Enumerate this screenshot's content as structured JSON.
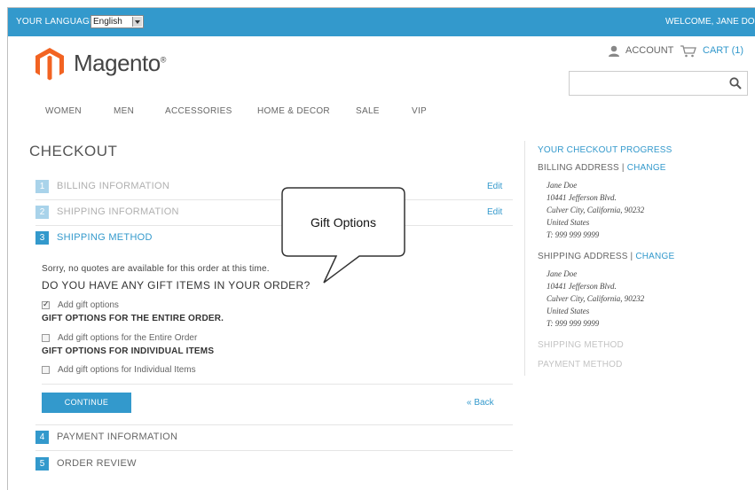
{
  "topbar": {
    "language_label": "YOUR LANGUAGE:",
    "language_value": "English",
    "welcome": "WELCOME, JANE DOE"
  },
  "header": {
    "logo_text": "Magento",
    "logo_mark": "®",
    "account": "ACCOUNT",
    "cart": "CART (1)",
    "search_placeholder": ""
  },
  "nav": [
    "WOMEN",
    "MEN",
    "ACCESSORIES",
    "HOME & DECOR",
    "SALE",
    "VIP"
  ],
  "page_title": "CHECKOUT",
  "steps": [
    {
      "num": "1",
      "label": "BILLING INFORMATION",
      "edit": "Edit"
    },
    {
      "num": "2",
      "label": "SHIPPING INFORMATION",
      "edit": "Edit"
    },
    {
      "num": "3",
      "label": "SHIPPING METHOD"
    },
    {
      "num": "4",
      "label": "PAYMENT INFORMATION"
    },
    {
      "num": "5",
      "label": "ORDER REVIEW"
    }
  ],
  "shipping_method": {
    "message": "Sorry, no quotes are available for this order at this time.",
    "question": "DO YOU HAVE ANY GIFT ITEMS IN YOUR ORDER?",
    "add_gift": {
      "label": "Add gift options",
      "checked": true
    },
    "entire_order_head": "GIFT OPTIONS FOR THE ENTIRE ORDER.",
    "entire_order": {
      "label": "Add gift options for the Entire Order",
      "checked": false
    },
    "individual_head": "GIFT OPTIONS FOR INDIVIDUAL ITEMS",
    "individual": {
      "label": "Add gift options for Individual Items",
      "checked": false
    },
    "continue": "CONTINUE",
    "back": "« Back"
  },
  "callout": "Gift Options",
  "progress": {
    "title": "YOUR CHECKOUT PROGRESS",
    "billing_label": "BILLING ADDRESS",
    "separator": " | ",
    "change": "CHANGE",
    "billing_address": [
      "Jane Doe",
      "10441 Jefferson Blvd.",
      "Culver City, California, 90232",
      "United States",
      "T: 999 999 9999"
    ],
    "shipping_label": "SHIPPING ADDRESS",
    "shipping_address": [
      "Jane Doe",
      "10441 Jefferson Blvd.",
      "Culver City, California, 90232",
      "United States",
      "T: 999 999 9999"
    ],
    "shipping_method": "SHIPPING METHOD",
    "payment_method": "PAYMENT METHOD"
  },
  "colors": {
    "accent": "#3399cc",
    "logo_orange": "#f26322"
  }
}
